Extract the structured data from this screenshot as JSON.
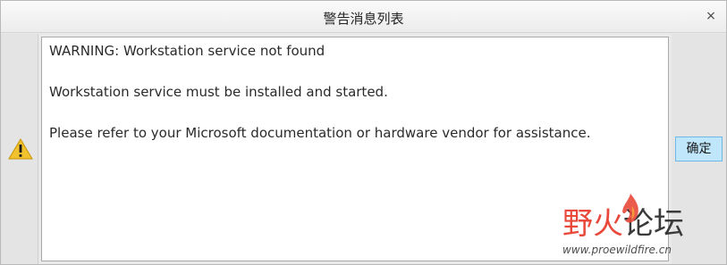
{
  "dialog": {
    "title": "警告消息列表",
    "close_label": "×",
    "ok_label": "确定"
  },
  "icons": {
    "warning": "warning-icon",
    "close": "close-icon"
  },
  "message": {
    "lines": [
      "WARNING: Workstation service not found",
      "",
      "Workstation service must be installed and started.",
      "",
      "Please refer to your Microsoft documentation or hardware vendor for assistance."
    ]
  },
  "watermark": {
    "text_red": "野",
    "text_red2": "火",
    "text_dark": "论坛",
    "url": "www.proewildfire.cn"
  },
  "colors": {
    "ok_button_bg": "#bfe6fb",
    "ok_button_border": "#6cb8e6",
    "warning_yellow": "#f2c12e",
    "watermark_red": "#e8493a"
  }
}
